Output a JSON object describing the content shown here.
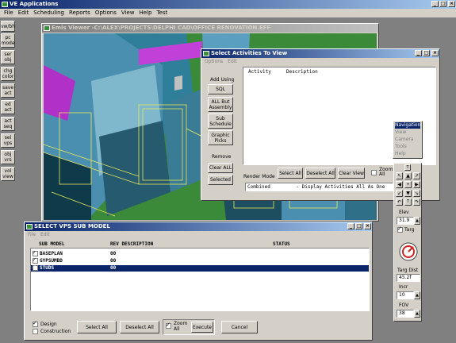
{
  "app": {
    "title": "VE Applications",
    "menu": [
      "File",
      "Edit",
      "Scheduling",
      "Reports",
      "Options",
      "View",
      "Help",
      "Test"
    ]
  },
  "left_toolbar": [
    "vw/bh",
    "pc\nmode",
    "ser\nobj",
    "chg\ncolor",
    "save\nact",
    "ed\nact",
    "act\nseq",
    "sel\nvps",
    "obj\nvrs",
    "vol\nview"
  ],
  "emis": {
    "title": "Emis Viewer -C:\\ALEX\\PROJECTS\\DELPHI CAD\\OFFICE RENOVATION.EFF"
  },
  "activities": {
    "title": "Select Activities To View",
    "menu": [
      "Options",
      "Edit"
    ],
    "add_using_label": "Add Using",
    "sql": "SQL",
    "all_but_assembly": "ALL But\nAssembly",
    "sub_schedule": "Sub\nSchedule",
    "graphic_picks": "Graphic\nPicks",
    "remove_label": "Remove",
    "clear_all": "Clear ALL",
    "selected": "Selected",
    "col_activity": "Activity",
    "col_description": "Description",
    "render_mode": "Render Mode",
    "select_all": "Select All",
    "deselect_all": "Deselect All",
    "clear_view": "Clear View",
    "zoom_all": "Zoom\nAll",
    "render_value": "Combined         - Display Activities All As One"
  },
  "context_menu": [
    "Navigation",
    "View",
    "Camera",
    "Tools",
    "Help"
  ],
  "nav": {
    "elev": "Elev",
    "elev_value": "31.9",
    "targ": "Targ",
    "targ_dist": "Targ Dist",
    "targ_dist_value": "45.2f",
    "incr": "Incr",
    "incr_value": "10",
    "fov": "FOV",
    "fov_value": "38"
  },
  "vps": {
    "title": "SELECT VPS SUB MODEL",
    "menu": [
      "File",
      "Edit"
    ],
    "headers": [
      "SUB MODEL",
      "REV DESCRIPTION",
      "STATUS"
    ],
    "rows": [
      {
        "name": "BASEPLAN",
        "rev": "00",
        "status": ""
      },
      {
        "name": "GYPSUMBD",
        "rev": "00",
        "status": ""
      },
      {
        "name": "STUDS",
        "rev": "00",
        "status": ""
      }
    ],
    "design": "Design",
    "construction": "Construction",
    "select_all": "Select All",
    "deselect_all": "Deselect All",
    "zoom_all": "Zoom\nAll",
    "execute": "Execute",
    "cancel": "Cancel"
  }
}
